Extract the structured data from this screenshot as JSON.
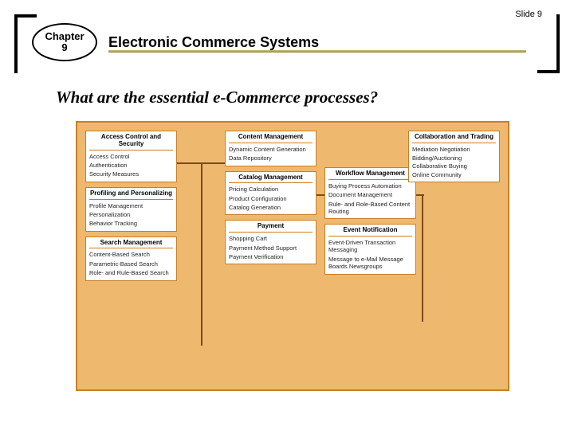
{
  "slide_number": "Slide 9",
  "chapter_label": "Chapter",
  "chapter_number": "9",
  "title": "Electronic Commerce Systems",
  "question": "What are the essential e-Commerce processes?",
  "blocks": [
    {
      "id": "access",
      "col": 1,
      "heading": "Access Control and Security",
      "items": [
        "Access Control",
        "Authentication",
        "Security Measures"
      ]
    },
    {
      "id": "profiling",
      "col": 1,
      "heading": "Profiling and Personalizing",
      "items": [
        "Profile Management",
        "Personalization",
        "Behavior Tracking"
      ]
    },
    {
      "id": "search",
      "col": 1,
      "heading": "Search Management",
      "items": [
        "Content-Based Search",
        "Parametric-Based Search",
        "Role- and Rule-Based Search"
      ]
    },
    {
      "id": "content",
      "col": 2,
      "heading": "Content Management",
      "items": [
        "Dynamic Content Generation",
        "Data Repository"
      ]
    },
    {
      "id": "catalog",
      "col": 2,
      "heading": "Catalog Management",
      "items": [
        "Pricing Calculation",
        "Product Configuration",
        "Catalog Generation"
      ]
    },
    {
      "id": "payment",
      "col": 2,
      "heading": "Payment",
      "items": [
        "Shopping Cart",
        "Payment Method Support",
        "Payment Verification"
      ]
    },
    {
      "id": "workflow",
      "col": 3,
      "heading": "Workflow Management",
      "items": [
        "Buying Process Automation",
        "Document Management",
        "Rule- and Role-Based Content Routing"
      ]
    },
    {
      "id": "event",
      "col": 3,
      "heading": "Event Notification",
      "items": [
        "Event-Driven Transaction Messaging",
        "Message to e-Mail Message Boards Newsgroups"
      ]
    },
    {
      "id": "collab",
      "col": 4,
      "heading": "Collaboration and Trading",
      "items": [
        "Mediation Negotiation",
        "Bidding/Auctioning Collaborative Buying",
        "Online Community"
      ]
    }
  ]
}
